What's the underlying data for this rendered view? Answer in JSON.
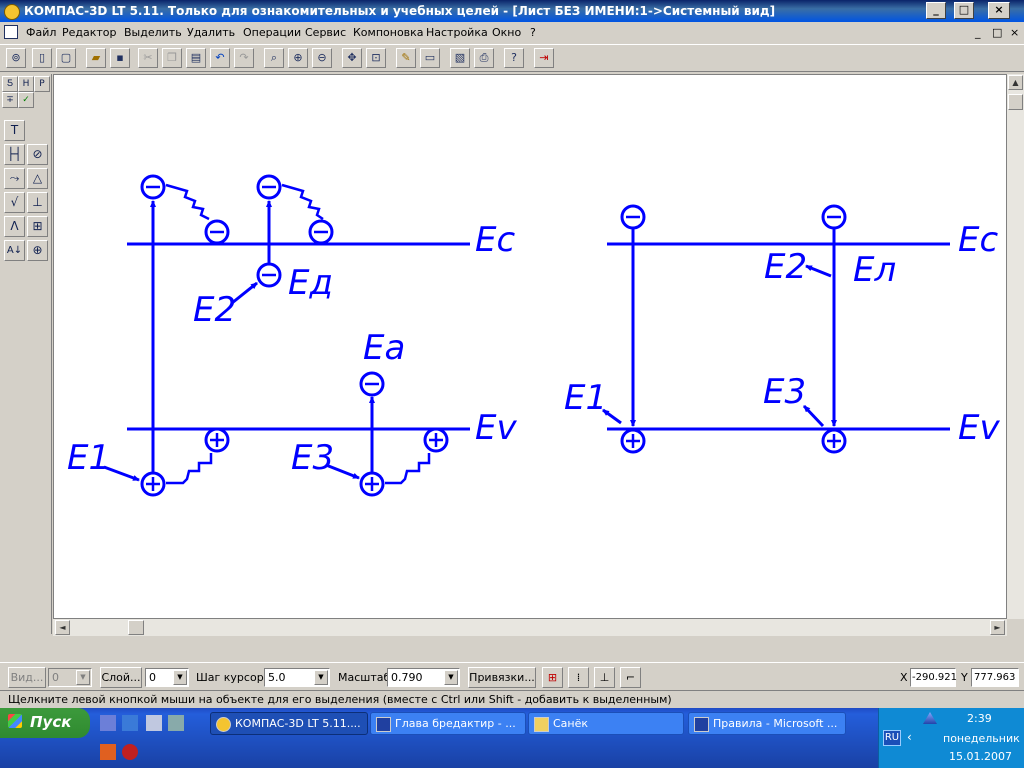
{
  "window": {
    "title": "КОМПАС-3D LT 5.11. Только для ознакомительных и учебных целей - [Лист БЕЗ ИМЕНИ:1->Системный вид]",
    "buttons": [
      "_",
      "□",
      "×"
    ]
  },
  "menu": {
    "items": [
      "Файл",
      "Редактор",
      "Выделить",
      "Удалить",
      "Операции",
      "Сервис",
      "Компоновка",
      "Настройка",
      "Окно",
      "?"
    ],
    "mdi_buttons": [
      "_",
      "□",
      "×"
    ]
  },
  "toolbar": {
    "icons": [
      "new-file-icon",
      "new-sheet-icon",
      "new-fragment-icon",
      "open-icon",
      "save-icon",
      "cut-icon",
      "copy-icon",
      "paste-icon",
      "undo-icon",
      "redo-icon",
      "zoom-window-icon",
      "zoom-in-icon",
      "zoom-out-icon",
      "pan-icon",
      "zoom-fit-icon",
      "edit-icon",
      "props-icon",
      "print-preview-icon",
      "print-icon",
      "help-icon",
      "exit-icon"
    ]
  },
  "palette": {
    "tabs": [
      "Ƽ",
      "H",
      "P"
    ],
    "tools": [
      "T",
      "├┤",
      "⊘",
      "⤳",
      "△",
      "√",
      "⊥",
      "Λ",
      "⊞",
      "A↓",
      "⊕"
    ]
  },
  "drawing": {
    "left_labels": {
      "Ec": "Ec",
      "Ed": "Eд",
      "Ea": "Ea",
      "Ev": "Ev",
      "E1": "E1",
      "E2": "E2",
      "E3": "E3"
    },
    "right_labels": {
      "Ec": "Ec",
      "El": "Eл",
      "Ev": "Ev",
      "E1": "E1",
      "E2": "E2",
      "E3": "E3"
    }
  },
  "status": {
    "vid_label": "Вид...",
    "vid_value": "0",
    "layer_label": "Слой...",
    "layer_value": "0",
    "step_label": "Шаг курсора",
    "step_value": "5.0",
    "scale_label": "Масштаб",
    "scale_value": "0.790",
    "snap_label": "Привязки...",
    "x_label": "X",
    "x_value": "-290.921",
    "y_label": "Y",
    "y_value": "777.963",
    "hint": "Щелкните левой кнопкой мыши на объекте для его выделения (вместе с Ctrl или Shift - добавить к выделенным)"
  },
  "taskbar": {
    "start": "Пуск",
    "tasks": [
      "КОМПАС-3D LT 5.11....",
      "Глава бредактир - ...",
      "Санёк",
      "Правила - Microsoft ..."
    ],
    "lang": "RU",
    "time": "2:39",
    "day": "понедельник",
    "date": "15.01.2007"
  },
  "colors": {
    "accent": "#0000ff",
    "titlebar": "#0a246a",
    "taskbar": "#245edb"
  }
}
